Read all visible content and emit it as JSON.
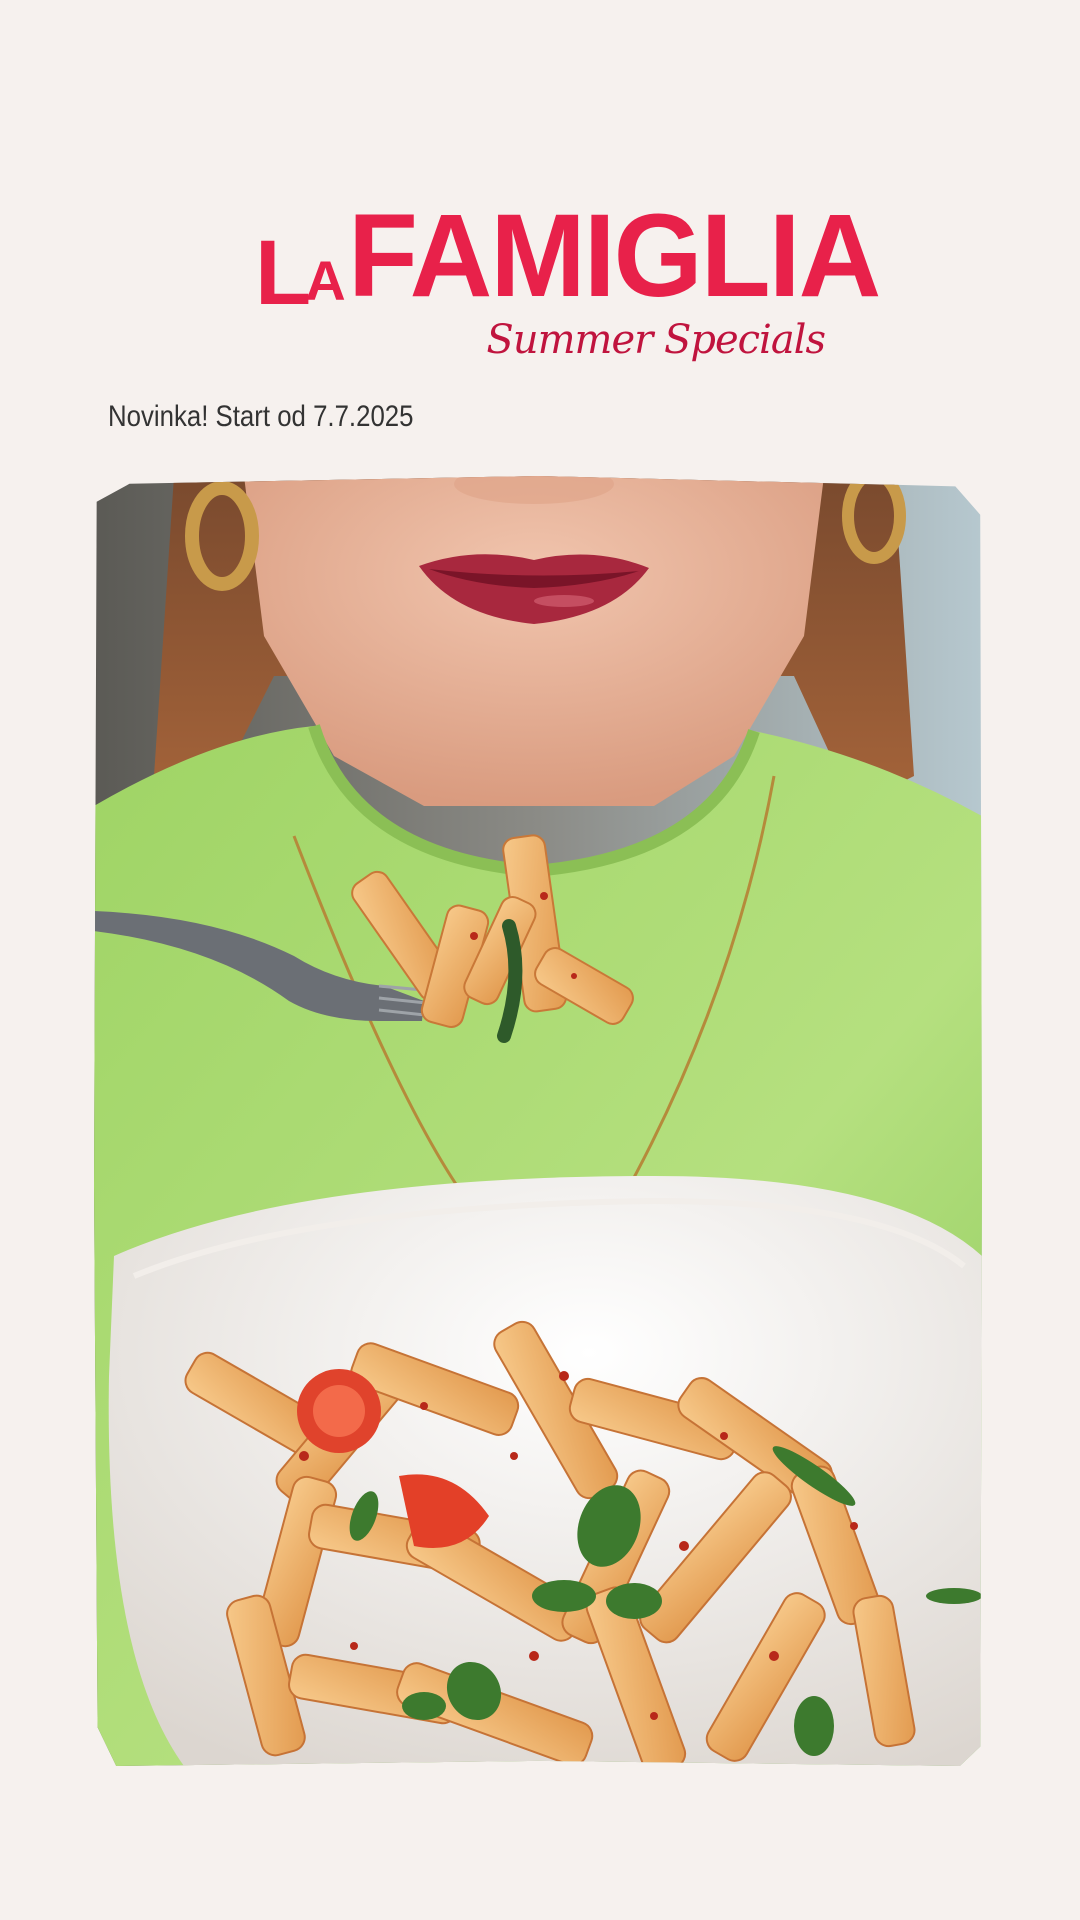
{
  "brand": {
    "prefix": "La",
    "name": "Famiglia",
    "subtitle": "Summer Specials",
    "color": "#e8214a"
  },
  "tagline": "Novinka! Start od 7.7.2025",
  "photo": {
    "icon": "pasta-photo"
  }
}
